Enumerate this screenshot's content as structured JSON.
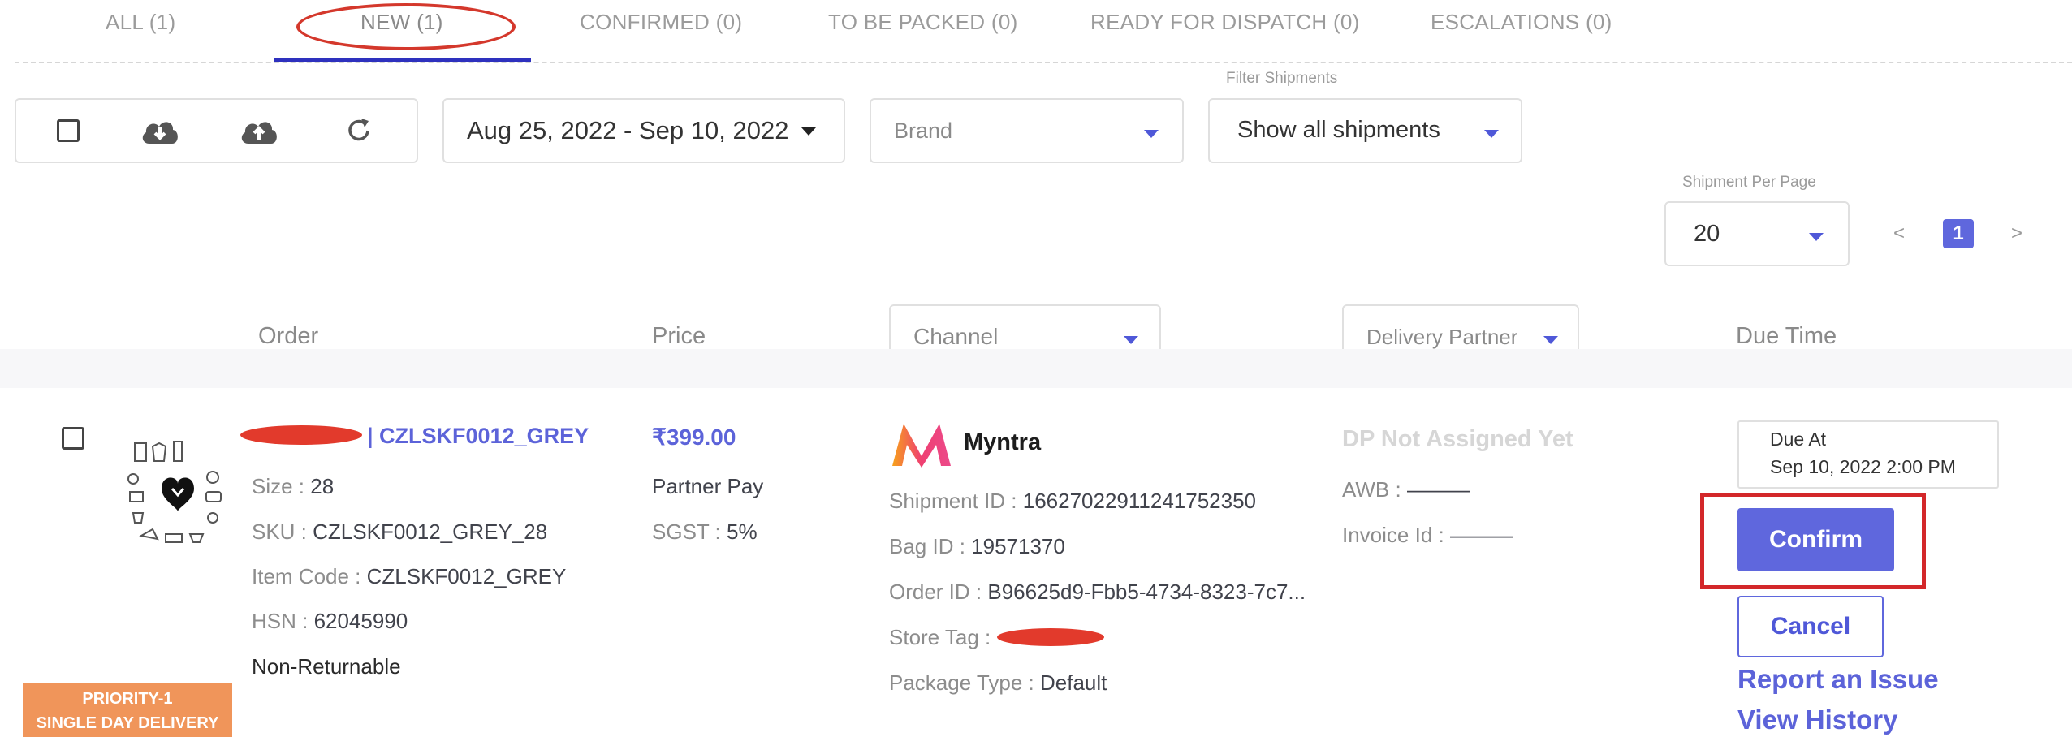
{
  "tabs": [
    {
      "label": "ALL (1)"
    },
    {
      "label": "NEW (1)"
    },
    {
      "label": "CONFIRMED (0)"
    },
    {
      "label": "TO BE PACKED (0)"
    },
    {
      "label": "READY FOR DISPATCH (0)"
    },
    {
      "label": "ESCALATIONS (0)"
    }
  ],
  "active_tab": "NEW (1)",
  "toolbar": {
    "date_range": "Aug 25, 2022 - Sep 10, 2022",
    "brand_placeholder": "Brand",
    "filter_label": "Filter Shipments",
    "filter_value": "Show all shipments",
    "per_page_label": "Shipment Per Page",
    "per_page_value": "20",
    "pagination": {
      "prev": "<",
      "current": "1",
      "next": ">"
    }
  },
  "columns": {
    "order": "Order",
    "price": "Price",
    "channel": "Channel",
    "delivery_partner": "Delivery Partner",
    "due_time": "Due Time"
  },
  "order": {
    "title": "| CZLSKF0012_GREY",
    "size_label": "Size : ",
    "size": "28",
    "sku_label": "SKU : ",
    "sku": "CZLSKF0012_GREY_28",
    "item_code_label": "Item Code : ",
    "item_code": "CZLSKF0012_GREY",
    "hsn_label": "HSN : ",
    "hsn": "62045990",
    "returnable": "Non-Returnable",
    "priority_line1": "PRIORITY-1",
    "priority_line2": "SINGLE DAY DELIVERY"
  },
  "price": {
    "amount": "₹399.00",
    "pay_type": "Partner Pay",
    "tax_label": "SGST : ",
    "tax": "5%"
  },
  "channel": {
    "name": "Myntra",
    "logo_letter": "M",
    "shipment_id_label": "Shipment ID : ",
    "shipment_id": "16627022911241752350",
    "bag_id_label": "Bag ID : ",
    "bag_id": "19571370",
    "order_id_label": "Order ID : ",
    "order_id": "B96625d9-Fbb5-4734-8323-7c7...",
    "store_tag_label": "Store Tag :",
    "package_type_label": "Package Type : ",
    "package_type": "Default"
  },
  "delivery": {
    "status": "DP Not Assigned Yet",
    "awb_label": "AWB : ",
    "awb": "———",
    "invoice_label": "Invoice Id : ",
    "invoice": "———"
  },
  "due": {
    "label": "Due At",
    "value": "Sep 10, 2022 2:00 PM"
  },
  "actions": {
    "confirm": "Confirm",
    "cancel": "Cancel",
    "report": "Report an Issue",
    "history": "View History"
  },
  "colors": {
    "accent": "#5f67dd",
    "tab_underline": "#2e31be",
    "annotation_red": "#d3272a",
    "priority_orange": "#f0955a"
  }
}
